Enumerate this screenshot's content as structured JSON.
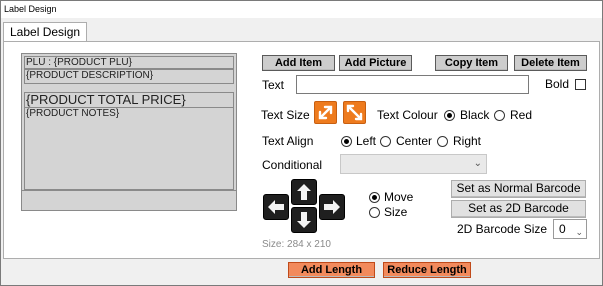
{
  "window": {
    "title": "Label Design"
  },
  "tabs": [
    {
      "label": "Label Design"
    }
  ],
  "preview": {
    "rows": [
      "PLU : {PRODUCT PLU}",
      "{PRODUCT DESCRIPTION}",
      "{PRODUCT TOTAL PRICE}",
      "{PRODUCT NOTES}"
    ],
    "size_text": "Size: 284 x 210"
  },
  "toolbar": {
    "add_item": "Add Item",
    "add_picture": "Add Picture",
    "copy_item": "Copy Item",
    "delete_item": "Delete Item"
  },
  "form": {
    "text_label": "Text",
    "text_value": "",
    "bold_label": "Bold",
    "bold_checked": false,
    "text_size_label": "Text Size",
    "text_colour_label": "Text Colour",
    "colour_options": [
      "Black",
      "Red"
    ],
    "colour_selected": "Black",
    "text_align_label": "Text Align",
    "align_options": [
      "Left",
      "Center",
      "Right"
    ],
    "align_selected": "Left",
    "conditional_label": "Conditional",
    "conditional_value": ""
  },
  "move": {
    "options": [
      "Move",
      "Size"
    ],
    "selected": "Move"
  },
  "barcode": {
    "normal_button": "Set as Normal Barcode",
    "twod_button": "Set as 2D Barcode",
    "size_label": "2D Barcode Size",
    "size_value": "0"
  },
  "footer": {
    "add_length": "Add Length",
    "reduce_length": "Reduce Length"
  },
  "colors": {
    "accent_orange": "#f28a5c",
    "icon_orange": "#ee7b1e",
    "button_gray": "#cdcdcd"
  },
  "icons": {
    "text_size_up": "expand-arrow-icon",
    "text_size_down": "shrink-arrow-icon",
    "arrows": [
      "arrow-up-icon",
      "arrow-left-icon",
      "arrow-right-icon",
      "arrow-down-icon"
    ]
  }
}
